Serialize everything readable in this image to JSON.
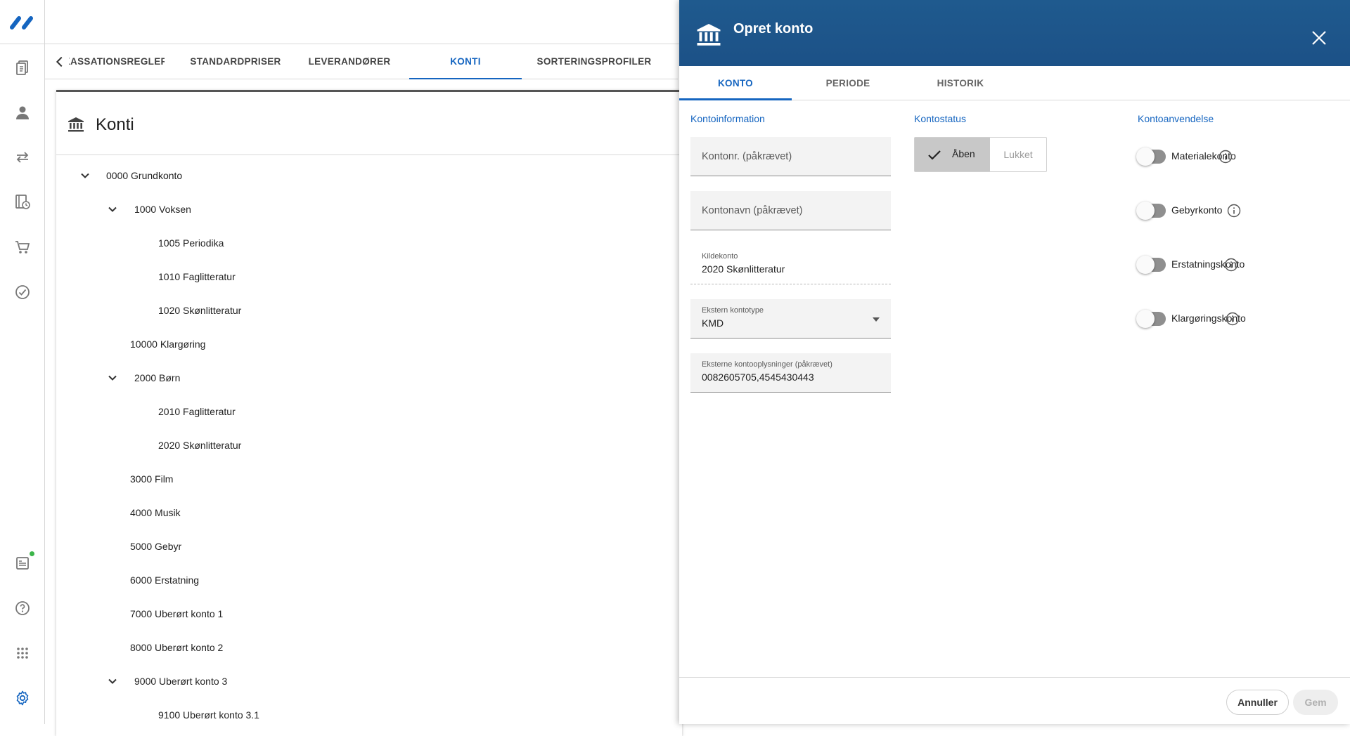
{
  "top_tabs": [
    {
      "label": "KASSATIONSREGLER",
      "active": false
    },
    {
      "label": "STANDARDPRISER",
      "active": false
    },
    {
      "label": "LEVERANDØRER",
      "active": false
    },
    {
      "label": "KONTI",
      "active": true
    },
    {
      "label": "SORTERINGSPROFILER",
      "active": false
    }
  ],
  "card": {
    "title": "Konti",
    "tree": [
      {
        "label": "0000 Grundkonto",
        "expanded": true
      },
      {
        "label": "1000 Voksen",
        "expanded": true
      },
      {
        "label": "1005 Periodika"
      },
      {
        "label": "1010 Faglitteratur"
      },
      {
        "label": "1020 Skønlitteratur"
      },
      {
        "label": "10000 Klargøring"
      },
      {
        "label": "2000 Børn",
        "expanded": true
      },
      {
        "label": "2010 Faglitteratur"
      },
      {
        "label": "2020 Skønlitteratur"
      },
      {
        "label": "3000 Film"
      },
      {
        "label": "4000 Musik"
      },
      {
        "label": "5000 Gebyr"
      },
      {
        "label": "6000 Erstatning"
      },
      {
        "label": "7000 Uberørt konto 1"
      },
      {
        "label": "8000 Uberørt konto 2"
      },
      {
        "label": "9000 Uberørt konto 3",
        "expanded": true
      },
      {
        "label": "9100 Uberørt konto 3.1"
      }
    ]
  },
  "panel": {
    "title": "Opret konto",
    "tabs": [
      {
        "label": "KONTO",
        "active": true
      },
      {
        "label": "PERIODE",
        "active": false
      },
      {
        "label": "HISTORIK",
        "active": false
      }
    ],
    "sections": {
      "info": "Kontoinformation",
      "status": "Kontostatus",
      "usage": "Kontoanvendelse"
    },
    "fields": {
      "kontonr_placeholder": "Kontonr. (påkrævet)",
      "kontonavn_placeholder": "Kontonavn (påkrævet)",
      "kildekonto_label": "Kildekonto",
      "kildekonto_value": "2020 Skønlitteratur",
      "ekstern_type_label": "Ekstern kontotype",
      "ekstern_type_value": "KMD",
      "eksterne_opl_label": "Eksterne kontooplysninger (påkrævet)",
      "eksterne_opl_value": "0082605705,4545430443"
    },
    "status": {
      "open_label": "Åben",
      "closed_label": "Lukket",
      "selected": "Åben"
    },
    "toggles": [
      {
        "label": "Materialekonto",
        "on": false
      },
      {
        "label": "Gebyrkonto",
        "on": false
      },
      {
        "label": "Erstatningskonto",
        "on": false
      },
      {
        "label": "Klargøringskonto",
        "on": false
      }
    ],
    "buttons": {
      "cancel": "Annuller",
      "save": "Gem"
    }
  },
  "colors": {
    "accent": "#1565c0",
    "header_bg": "#1f5a8e",
    "notification_dot": "#3bb54a"
  }
}
